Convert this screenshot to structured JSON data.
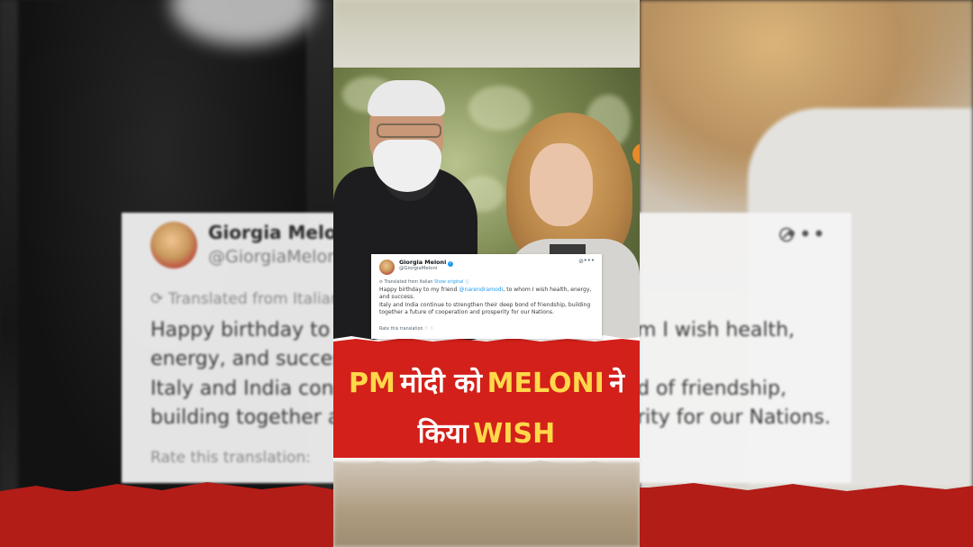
{
  "background_tweet": {
    "author_name": "Giorgia Meloni",
    "author_handle": "@GiorgiaMeloni",
    "translated_note": "Translated from Italian",
    "lines_left": [
      "Happy birthday to m",
      "energy, and success",
      "Italy and India conti",
      "building together a f"
    ],
    "lines_right": [
      "m I wish health,",
      "",
      "d of friendship,",
      "rity for our Nations."
    ],
    "rate_label": "Rate this translation:"
  },
  "tweet_card": {
    "author_name": "Giorgia Meloni",
    "author_handle": "@GiorgiaMeloni",
    "translated_note": "Translated from Italian",
    "show_original": "Show original",
    "body_before_mention": "Happy birthday to my friend ",
    "mention": "@narendramodi",
    "body_after_mention": ", to whom I wish health, energy, and success.",
    "body_line2": "Italy and India continue to strengthen their deep bond of friendship, building together a future of cooperation and prosperity for our Nations.",
    "rate_label": "Rate this translation"
  },
  "headline": {
    "pm": "PM",
    "modi_ko": "मोदी को",
    "meloni": "MELONI",
    "ne": "ने",
    "kiya": "किया",
    "wish": "WISH"
  },
  "colors": {
    "banner_red": "#d3201a",
    "headline_yellow": "#ffd84a",
    "mention_blue": "#1d9bf0"
  },
  "icons": [
    "grok-icon",
    "more-icon",
    "verified-badge-icon",
    "translate-icon"
  ]
}
